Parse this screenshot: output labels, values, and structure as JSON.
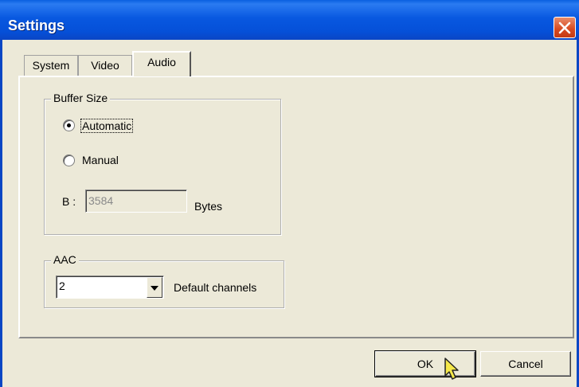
{
  "window": {
    "title": "Settings",
    "close_icon": "close-icon"
  },
  "tabs": [
    {
      "label": "System",
      "active": false
    },
    {
      "label": "Video",
      "active": false
    },
    {
      "label": "Audio",
      "active": true
    }
  ],
  "buffer_size": {
    "group_label": "Buffer Size",
    "options": [
      {
        "label": "Automatic",
        "selected": true,
        "focused": true
      },
      {
        "label": "Manual",
        "selected": false,
        "focused": false
      }
    ],
    "field_label": "B :",
    "field_value": "3584",
    "unit_label": "Bytes",
    "field_enabled": false
  },
  "aac": {
    "group_label": "AAC",
    "channels_value": "2",
    "channels_label": "Default channels"
  },
  "buttons": {
    "ok": "OK",
    "cancel": "Cancel"
  },
  "colors": {
    "titlebar": "#0550d8",
    "close_button": "#d8491f",
    "face": "#ece9d8"
  }
}
